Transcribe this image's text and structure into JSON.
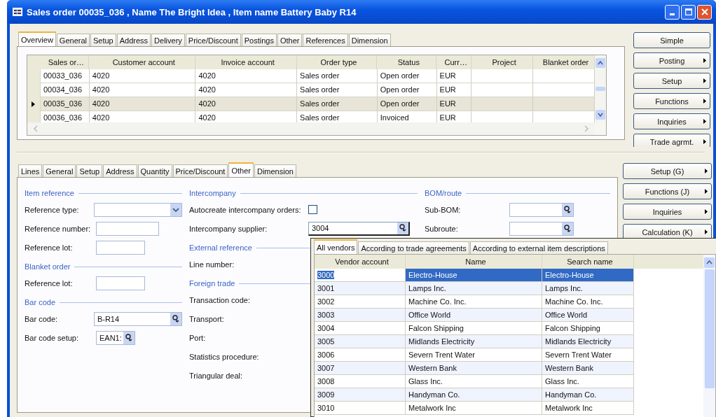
{
  "window": {
    "title": "Sales order 00035_036 , Name The Bright Idea , Item name Battery Baby R14"
  },
  "header_tabs": [
    {
      "label": "Overview",
      "selected": true
    },
    {
      "label": "General",
      "selected": false
    },
    {
      "label": "Setup",
      "selected": false
    },
    {
      "label": "Address",
      "selected": false
    },
    {
      "label": "Delivery",
      "selected": false
    },
    {
      "label": "Price/Discount",
      "selected": false
    },
    {
      "label": "Postings",
      "selected": false
    },
    {
      "label": "Other",
      "selected": false
    },
    {
      "label": "References",
      "selected": false
    },
    {
      "label": "Dimension",
      "selected": false
    }
  ],
  "orders_table": {
    "columns": [
      "Sales or…",
      "Customer account",
      "Invoice account",
      "Order type",
      "Status",
      "Curr…",
      "Project",
      "Blanket order"
    ],
    "rows": [
      {
        "selected": false,
        "cells": [
          "00033_036",
          "4020",
          "4020",
          "Sales order",
          "Open order",
          "EUR",
          "",
          ""
        ]
      },
      {
        "selected": false,
        "cells": [
          "00034_036",
          "4020",
          "4020",
          "Sales order",
          "Open order",
          "EUR",
          "",
          ""
        ]
      },
      {
        "selected": true,
        "cells": [
          "00035_036",
          "4020",
          "4020",
          "Sales order",
          "Open order",
          "EUR",
          "",
          ""
        ]
      },
      {
        "selected": false,
        "cells": [
          "00036_036",
          "4020",
          "4020",
          "Sales order",
          "Invoiced",
          "EUR",
          "",
          ""
        ]
      }
    ]
  },
  "header_buttons": [
    {
      "label": "Simple",
      "has_menu": false
    },
    {
      "label": "Posting",
      "has_menu": true
    },
    {
      "label": "Setup",
      "has_menu": true
    },
    {
      "label": "Functions",
      "has_menu": true
    },
    {
      "label": "Inquiries",
      "has_menu": true
    },
    {
      "label": "Trade agrmt.",
      "has_menu": true
    }
  ],
  "line_tabs": [
    {
      "label": "Lines",
      "selected": false
    },
    {
      "label": "General",
      "selected": false
    },
    {
      "label": "Setup",
      "selected": false
    },
    {
      "label": "Address",
      "selected": false
    },
    {
      "label": "Quantity",
      "selected": false
    },
    {
      "label": "Price/Discount",
      "selected": false
    },
    {
      "label": "Other",
      "selected": true
    },
    {
      "label": "Dimension",
      "selected": false
    }
  ],
  "line_buttons": [
    {
      "label": "Setup (G)",
      "has_menu": true
    },
    {
      "label": "Functions (J)",
      "has_menu": true
    },
    {
      "label": "Inquiries",
      "has_menu": true
    },
    {
      "label": "Calculation (K)",
      "has_menu": true
    }
  ],
  "form_columns": [
    [
      {
        "title": "Item reference",
        "fields": [
          {
            "label": "Reference type:",
            "kind": "dropdown"
          },
          {
            "label": "Reference number:",
            "kind": "text"
          },
          {
            "label": "Reference lot:",
            "kind": "text"
          }
        ]
      },
      {
        "title": "Blanket order",
        "fields": [
          {
            "label": "Reference lot:",
            "kind": "text"
          }
        ]
      },
      {
        "title": "Bar code",
        "fields": [
          {
            "label": "Bar code:",
            "kind": "lookup",
            "value": "B-R14",
            "focused": false
          },
          {
            "label": "Bar code setup:",
            "kind": "lookup",
            "value": "EAN1:",
            "focused": false
          }
        ]
      }
    ],
    [
      {
        "title": "Intercompany",
        "fields": [
          {
            "label": "Autocreate intercompany orders:",
            "kind": "checkbox",
            "checked": false
          },
          {
            "label": "Intercompany supplier:",
            "kind": "lookup",
            "value": "3004",
            "focused": true
          }
        ]
      },
      {
        "title": "External reference",
        "fields": [
          {
            "label": "Line number:",
            "kind": "label"
          }
        ]
      },
      {
        "title": "Foreign trade",
        "fields": [
          {
            "label": "Transaction code:",
            "kind": "label"
          },
          {
            "label": "Transport:",
            "kind": "label"
          },
          {
            "label": "Port:",
            "kind": "label"
          },
          {
            "label": "Statistics procedure:",
            "kind": "label"
          },
          {
            "label": "Triangular deal:",
            "kind": "label"
          }
        ]
      }
    ],
    [
      {
        "title": "BOM/route",
        "fields": [
          {
            "label": "Sub-BOM:",
            "kind": "lookup",
            "focused": false
          },
          {
            "label": "Subroute:",
            "kind": "lookup",
            "focused": false
          }
        ]
      }
    ]
  ],
  "vendor_lookup": {
    "tabs": [
      {
        "label": "All vendors",
        "selected": true
      },
      {
        "label": "According to trade agreements",
        "selected": false
      },
      {
        "label": "According to external item descriptions",
        "selected": false
      }
    ],
    "columns": [
      "Vendor account",
      "Name",
      "Search name"
    ],
    "rows": [
      {
        "selected": true,
        "cells": [
          "3000",
          "Electro-House",
          "Electro-House"
        ]
      },
      {
        "selected": false,
        "cells": [
          "3001",
          "Lamps Inc.",
          "Lamps Inc."
        ]
      },
      {
        "selected": false,
        "cells": [
          "3002",
          "Machine Co. Inc.",
          "Machine Co. Inc."
        ]
      },
      {
        "selected": false,
        "cells": [
          "3003",
          "Office World",
          "Office World"
        ]
      },
      {
        "selected": false,
        "cells": [
          "3004",
          "Falcon Shipping",
          "Falcon Shipping"
        ]
      },
      {
        "selected": false,
        "cells": [
          "3005",
          "Midlands Electricity",
          "Midlands Electricity"
        ]
      },
      {
        "selected": false,
        "cells": [
          "3006",
          "Severn Trent Water",
          "Severn Trent Water"
        ]
      },
      {
        "selected": false,
        "cells": [
          "3007",
          "Western Bank",
          "Western Bank"
        ]
      },
      {
        "selected": false,
        "cells": [
          "3008",
          "Glass Inc.",
          "Glass Inc."
        ]
      },
      {
        "selected": false,
        "cells": [
          "3009",
          "Handyman Co.",
          "Handyman Co."
        ]
      },
      {
        "selected": false,
        "cells": [
          "3010",
          "Metalwork Inc",
          "Metalwork Inc"
        ]
      }
    ]
  }
}
